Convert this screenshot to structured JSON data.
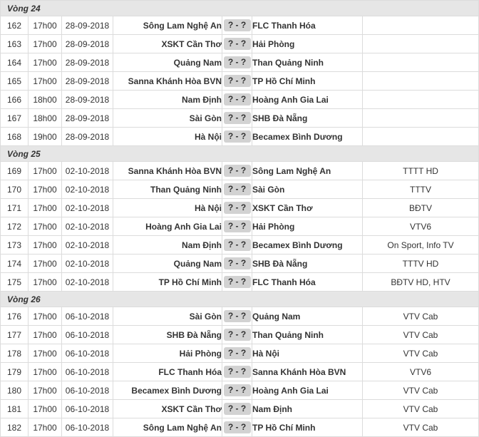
{
  "rounds": [
    {
      "label": "Vòng 24",
      "matches": [
        {
          "no": "162",
          "time": "17h00",
          "date": "28-09-2018",
          "home": "Sông Lam Nghệ An",
          "score": "? - ?",
          "away": "FLC Thanh Hóa",
          "tv": ""
        },
        {
          "no": "163",
          "time": "17h00",
          "date": "28-09-2018",
          "home": "XSKT Cần Thơ",
          "score": "? - ?",
          "away": "Hải Phòng",
          "tv": ""
        },
        {
          "no": "164",
          "time": "17h00",
          "date": "28-09-2018",
          "home": "Quảng Nam",
          "score": "? - ?",
          "away": "Than Quảng Ninh",
          "tv": ""
        },
        {
          "no": "165",
          "time": "17h00",
          "date": "28-09-2018",
          "home": "Sanna Khánh Hòa BVN",
          "score": "? - ?",
          "away": "TP Hồ Chí Minh",
          "tv": ""
        },
        {
          "no": "166",
          "time": "18h00",
          "date": "28-09-2018",
          "home": "Nam Định",
          "score": "? - ?",
          "away": "Hoàng Anh Gia Lai",
          "tv": ""
        },
        {
          "no": "167",
          "time": "18h00",
          "date": "28-09-2018",
          "home": "Sài Gòn",
          "score": "? - ?",
          "away": "SHB Đà Nẵng",
          "tv": ""
        },
        {
          "no": "168",
          "time": "19h00",
          "date": "28-09-2018",
          "home": "Hà Nội",
          "score": "? - ?",
          "away": "Becamex Bình Dương",
          "tv": ""
        }
      ]
    },
    {
      "label": "Vòng 25",
      "matches": [
        {
          "no": "169",
          "time": "17h00",
          "date": "02-10-2018",
          "home": "Sanna Khánh Hòa BVN",
          "score": "? - ?",
          "away": "Sông Lam Nghệ An",
          "tv": "TTTT HD"
        },
        {
          "no": "170",
          "time": "17h00",
          "date": "02-10-2018",
          "home": "Than Quảng Ninh",
          "score": "? - ?",
          "away": "Sài Gòn",
          "tv": "TTTV"
        },
        {
          "no": "171",
          "time": "17h00",
          "date": "02-10-2018",
          "home": "Hà Nội",
          "score": "? - ?",
          "away": "XSKT Cần Thơ",
          "tv": "BĐTV"
        },
        {
          "no": "172",
          "time": "17h00",
          "date": "02-10-2018",
          "home": "Hoàng Anh Gia Lai",
          "score": "? - ?",
          "away": "Hải Phòng",
          "tv": "VTV6"
        },
        {
          "no": "173",
          "time": "17h00",
          "date": "02-10-2018",
          "home": "Nam Định",
          "score": "? - ?",
          "away": "Becamex Bình Dương",
          "tv": "On Sport, Info TV"
        },
        {
          "no": "174",
          "time": "17h00",
          "date": "02-10-2018",
          "home": "Quảng Nam",
          "score": "? - ?",
          "away": "SHB Đà Nẵng",
          "tv": "TTTV HD"
        },
        {
          "no": "175",
          "time": "17h00",
          "date": "02-10-2018",
          "home": "TP Hồ Chí Minh",
          "score": "? - ?",
          "away": "FLC Thanh Hóa",
          "tv": "BĐTV HD, HTV"
        }
      ]
    },
    {
      "label": "Vòng 26",
      "matches": [
        {
          "no": "176",
          "time": "17h00",
          "date": "06-10-2018",
          "home": "Sài Gòn",
          "score": "? - ?",
          "away": "Quảng Nam",
          "tv": "VTV Cab"
        },
        {
          "no": "177",
          "time": "17h00",
          "date": "06-10-2018",
          "home": "SHB Đà Nẵng",
          "score": "? - ?",
          "away": "Than Quảng Ninh",
          "tv": "VTV Cab"
        },
        {
          "no": "178",
          "time": "17h00",
          "date": "06-10-2018",
          "home": "Hải Phòng",
          "score": "? - ?",
          "away": "Hà Nội",
          "tv": "VTV Cab"
        },
        {
          "no": "179",
          "time": "17h00",
          "date": "06-10-2018",
          "home": "FLC Thanh Hóa",
          "score": "? - ?",
          "away": "Sanna Khánh Hòa BVN",
          "tv": "VTV6"
        },
        {
          "no": "180",
          "time": "17h00",
          "date": "06-10-2018",
          "home": "Becamex Bình Dương",
          "score": "? - ?",
          "away": "Hoàng Anh Gia Lai",
          "tv": "VTV Cab"
        },
        {
          "no": "181",
          "time": "17h00",
          "date": "06-10-2018",
          "home": "XSKT Cần Thơ",
          "score": "? - ?",
          "away": "Nam Định",
          "tv": "VTV Cab"
        },
        {
          "no": "182",
          "time": "17h00",
          "date": "06-10-2018",
          "home": "Sông Lam Nghệ An",
          "score": "? - ?",
          "away": "TP Hồ Chí Minh",
          "tv": "VTV Cab"
        }
      ]
    }
  ]
}
